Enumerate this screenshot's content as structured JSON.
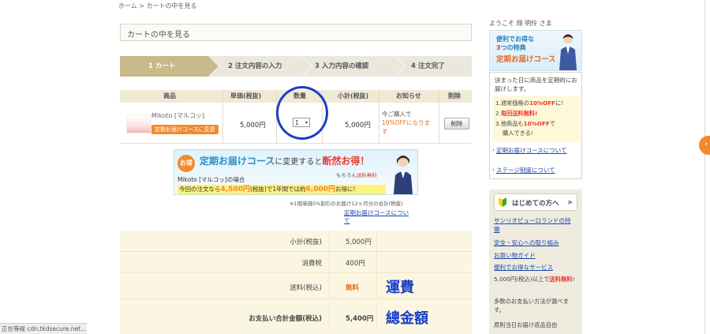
{
  "breadcrumb": "ホーム > カートの中を見る",
  "page_title": "カートの中を見る",
  "steps": [
    {
      "label": "1 カート"
    },
    {
      "label": "2 注文内容の入力"
    },
    {
      "label": "3 入力内容の確認"
    },
    {
      "label": "4 注文完了"
    }
  ],
  "table": {
    "headers": [
      "商品",
      "単価(税抜)",
      "数量",
      "小計(税抜)",
      "お知らせ",
      "削除"
    ],
    "row": {
      "product_name": "Mikoto [マルコッ]",
      "switch_button_label": "定期お届けコースに変更",
      "unit_price": "5,000円",
      "quantity": "1",
      "quantity_arrow": "▾",
      "subtotal": "5,000円",
      "notice_line1": "今ご購入で",
      "notice_line2": "10%OFFになります",
      "delete_label": "削除"
    }
  },
  "promo": {
    "badge": "お得",
    "headline_main": "定期お届けコース",
    "headline_mid": "に変更すると",
    "headline_end": "断然お得！",
    "sub_a": "もちろん",
    "sub_b": "送料無料",
    "product_line": "Mikoto [マルコッ]の場合",
    "highlight_a": "今回の注文なら",
    "highlight_b": "4,500円",
    "highlight_c": "(税抜)で1年間では約",
    "highlight_d": "6,000円",
    "highlight_e": "お得に!"
  },
  "promo_note": "※1個単価5%割引のお届け12ヶ月分の合計(税抜)",
  "course_link": "定期お届けコースについて",
  "totals": [
    {
      "label": "小計(税抜)",
      "value": "5,000円"
    },
    {
      "label": "消費税",
      "value": "400円"
    },
    {
      "label": "送料(税込)",
      "value": "無料"
    },
    {
      "label": "お支払い合計金額(税込)",
      "value": "5,400円"
    }
  ],
  "annotations": {
    "shipping": "運費",
    "total": "總金額"
  },
  "sidebar": {
    "welcome": "ようこそ 翔 明伶 さま",
    "banner1_line1": "便利でお得な",
    "banner1_line2_num": "3",
    "banner1_line2_rest": "つの特典",
    "banner1_line3": "定期お届けコース",
    "intro": "決まった日に商品を定期的にお届けします。",
    "benefits": [
      {
        "num": "1.",
        "text_a": "通常価格の",
        "text_b": "10%OFF",
        "text_c": "に!"
      },
      {
        "num": "2.",
        "text_b": "毎回送料無料!"
      },
      {
        "num": "3.",
        "text_a": "他商品も",
        "text_b": "10%OFF",
        "text_c": "で"
      },
      {
        "text_a": "購入できる!"
      }
    ],
    "links": [
      "定期お届けコースについて",
      "ステージ制度について"
    ],
    "beginner_title": "はじめての方へ",
    "beginner_links": [
      "サンリオピューロランドの特徴",
      "安全・安心への取り組み",
      "お買い物ガイド",
      "便利でお得なサービス"
    ],
    "beginner_texts": [
      {
        "a": "5,000円(税込)以上で",
        "b": "送料無料",
        "c": "!"
      },
      {
        "a": "多数のお支払い方法が選べます。"
      },
      {
        "a": "原則当日お届け返品自由"
      }
    ]
  },
  "status_bar": "正在等候 cdn.tkdsecure.net..."
}
